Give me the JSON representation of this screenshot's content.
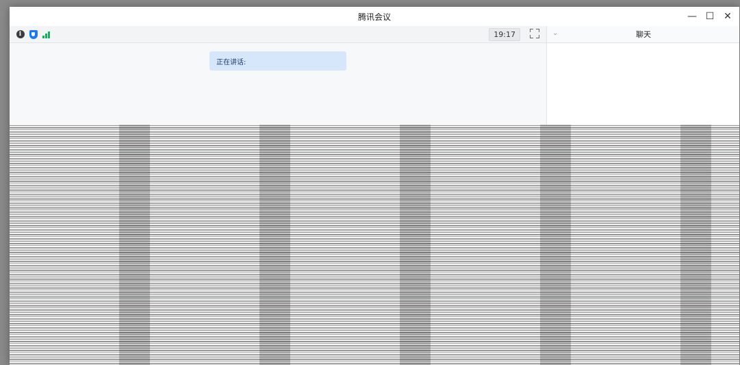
{
  "window": {
    "title": "腾讯会议",
    "controls": {
      "minimize_icon": "minimize-icon",
      "maximize_icon": "maximize-icon",
      "close_icon": "close-icon"
    }
  },
  "toolbar": {
    "icons": [
      "info-icon",
      "security-shield-icon",
      "signal-strength-icon"
    ],
    "timer": "19:17",
    "fullscreen_icon": "fullscreen-icon"
  },
  "stage": {
    "speaking_label": "正在讲话:"
  },
  "chat": {
    "title": "聊天",
    "collapse_icon": "chevron-down-icon"
  },
  "colors": {
    "accent_blue": "#1677ff",
    "signal_green": "#1aad5d",
    "speaking_bg": "#d6e7fb"
  }
}
